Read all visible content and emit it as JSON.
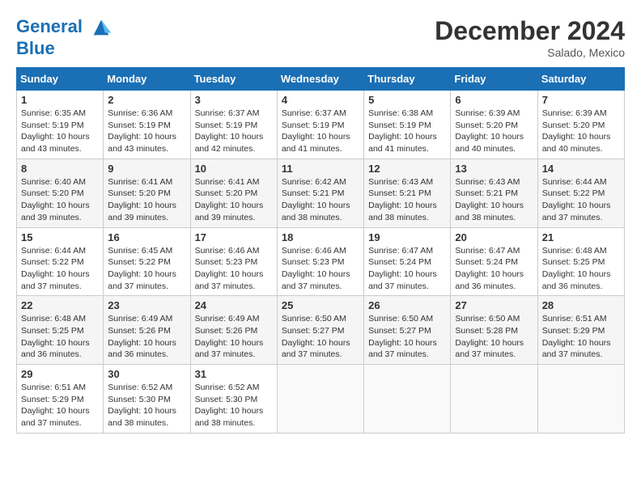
{
  "header": {
    "logo_line1": "General",
    "logo_line2": "Blue",
    "month": "December 2024",
    "location": "Salado, Mexico"
  },
  "weekdays": [
    "Sunday",
    "Monday",
    "Tuesday",
    "Wednesday",
    "Thursday",
    "Friday",
    "Saturday"
  ],
  "weeks": [
    [
      {
        "day": "1",
        "sunrise": "6:35 AM",
        "sunset": "5:19 PM",
        "daylight": "10 hours and 43 minutes."
      },
      {
        "day": "2",
        "sunrise": "6:36 AM",
        "sunset": "5:19 PM",
        "daylight": "10 hours and 43 minutes."
      },
      {
        "day": "3",
        "sunrise": "6:37 AM",
        "sunset": "5:19 PM",
        "daylight": "10 hours and 42 minutes."
      },
      {
        "day": "4",
        "sunrise": "6:37 AM",
        "sunset": "5:19 PM",
        "daylight": "10 hours and 41 minutes."
      },
      {
        "day": "5",
        "sunrise": "6:38 AM",
        "sunset": "5:19 PM",
        "daylight": "10 hours and 41 minutes."
      },
      {
        "day": "6",
        "sunrise": "6:39 AM",
        "sunset": "5:20 PM",
        "daylight": "10 hours and 40 minutes."
      },
      {
        "day": "7",
        "sunrise": "6:39 AM",
        "sunset": "5:20 PM",
        "daylight": "10 hours and 40 minutes."
      }
    ],
    [
      {
        "day": "8",
        "sunrise": "6:40 AM",
        "sunset": "5:20 PM",
        "daylight": "10 hours and 39 minutes."
      },
      {
        "day": "9",
        "sunrise": "6:41 AM",
        "sunset": "5:20 PM",
        "daylight": "10 hours and 39 minutes."
      },
      {
        "day": "10",
        "sunrise": "6:41 AM",
        "sunset": "5:20 PM",
        "daylight": "10 hours and 39 minutes."
      },
      {
        "day": "11",
        "sunrise": "6:42 AM",
        "sunset": "5:21 PM",
        "daylight": "10 hours and 38 minutes."
      },
      {
        "day": "12",
        "sunrise": "6:43 AM",
        "sunset": "5:21 PM",
        "daylight": "10 hours and 38 minutes."
      },
      {
        "day": "13",
        "sunrise": "6:43 AM",
        "sunset": "5:21 PM",
        "daylight": "10 hours and 38 minutes."
      },
      {
        "day": "14",
        "sunrise": "6:44 AM",
        "sunset": "5:22 PM",
        "daylight": "10 hours and 37 minutes."
      }
    ],
    [
      {
        "day": "15",
        "sunrise": "6:44 AM",
        "sunset": "5:22 PM",
        "daylight": "10 hours and 37 minutes."
      },
      {
        "day": "16",
        "sunrise": "6:45 AM",
        "sunset": "5:22 PM",
        "daylight": "10 hours and 37 minutes."
      },
      {
        "day": "17",
        "sunrise": "6:46 AM",
        "sunset": "5:23 PM",
        "daylight": "10 hours and 37 minutes."
      },
      {
        "day": "18",
        "sunrise": "6:46 AM",
        "sunset": "5:23 PM",
        "daylight": "10 hours and 37 minutes."
      },
      {
        "day": "19",
        "sunrise": "6:47 AM",
        "sunset": "5:24 PM",
        "daylight": "10 hours and 37 minutes."
      },
      {
        "day": "20",
        "sunrise": "6:47 AM",
        "sunset": "5:24 PM",
        "daylight": "10 hours and 36 minutes."
      },
      {
        "day": "21",
        "sunrise": "6:48 AM",
        "sunset": "5:25 PM",
        "daylight": "10 hours and 36 minutes."
      }
    ],
    [
      {
        "day": "22",
        "sunrise": "6:48 AM",
        "sunset": "5:25 PM",
        "daylight": "10 hours and 36 minutes."
      },
      {
        "day": "23",
        "sunrise": "6:49 AM",
        "sunset": "5:26 PM",
        "daylight": "10 hours and 36 minutes."
      },
      {
        "day": "24",
        "sunrise": "6:49 AM",
        "sunset": "5:26 PM",
        "daylight": "10 hours and 37 minutes."
      },
      {
        "day": "25",
        "sunrise": "6:50 AM",
        "sunset": "5:27 PM",
        "daylight": "10 hours and 37 minutes."
      },
      {
        "day": "26",
        "sunrise": "6:50 AM",
        "sunset": "5:27 PM",
        "daylight": "10 hours and 37 minutes."
      },
      {
        "day": "27",
        "sunrise": "6:50 AM",
        "sunset": "5:28 PM",
        "daylight": "10 hours and 37 minutes."
      },
      {
        "day": "28",
        "sunrise": "6:51 AM",
        "sunset": "5:29 PM",
        "daylight": "10 hours and 37 minutes."
      }
    ],
    [
      {
        "day": "29",
        "sunrise": "6:51 AM",
        "sunset": "5:29 PM",
        "daylight": "10 hours and 37 minutes."
      },
      {
        "day": "30",
        "sunrise": "6:52 AM",
        "sunset": "5:30 PM",
        "daylight": "10 hours and 38 minutes."
      },
      {
        "day": "31",
        "sunrise": "6:52 AM",
        "sunset": "5:30 PM",
        "daylight": "10 hours and 38 minutes."
      },
      null,
      null,
      null,
      null
    ]
  ]
}
